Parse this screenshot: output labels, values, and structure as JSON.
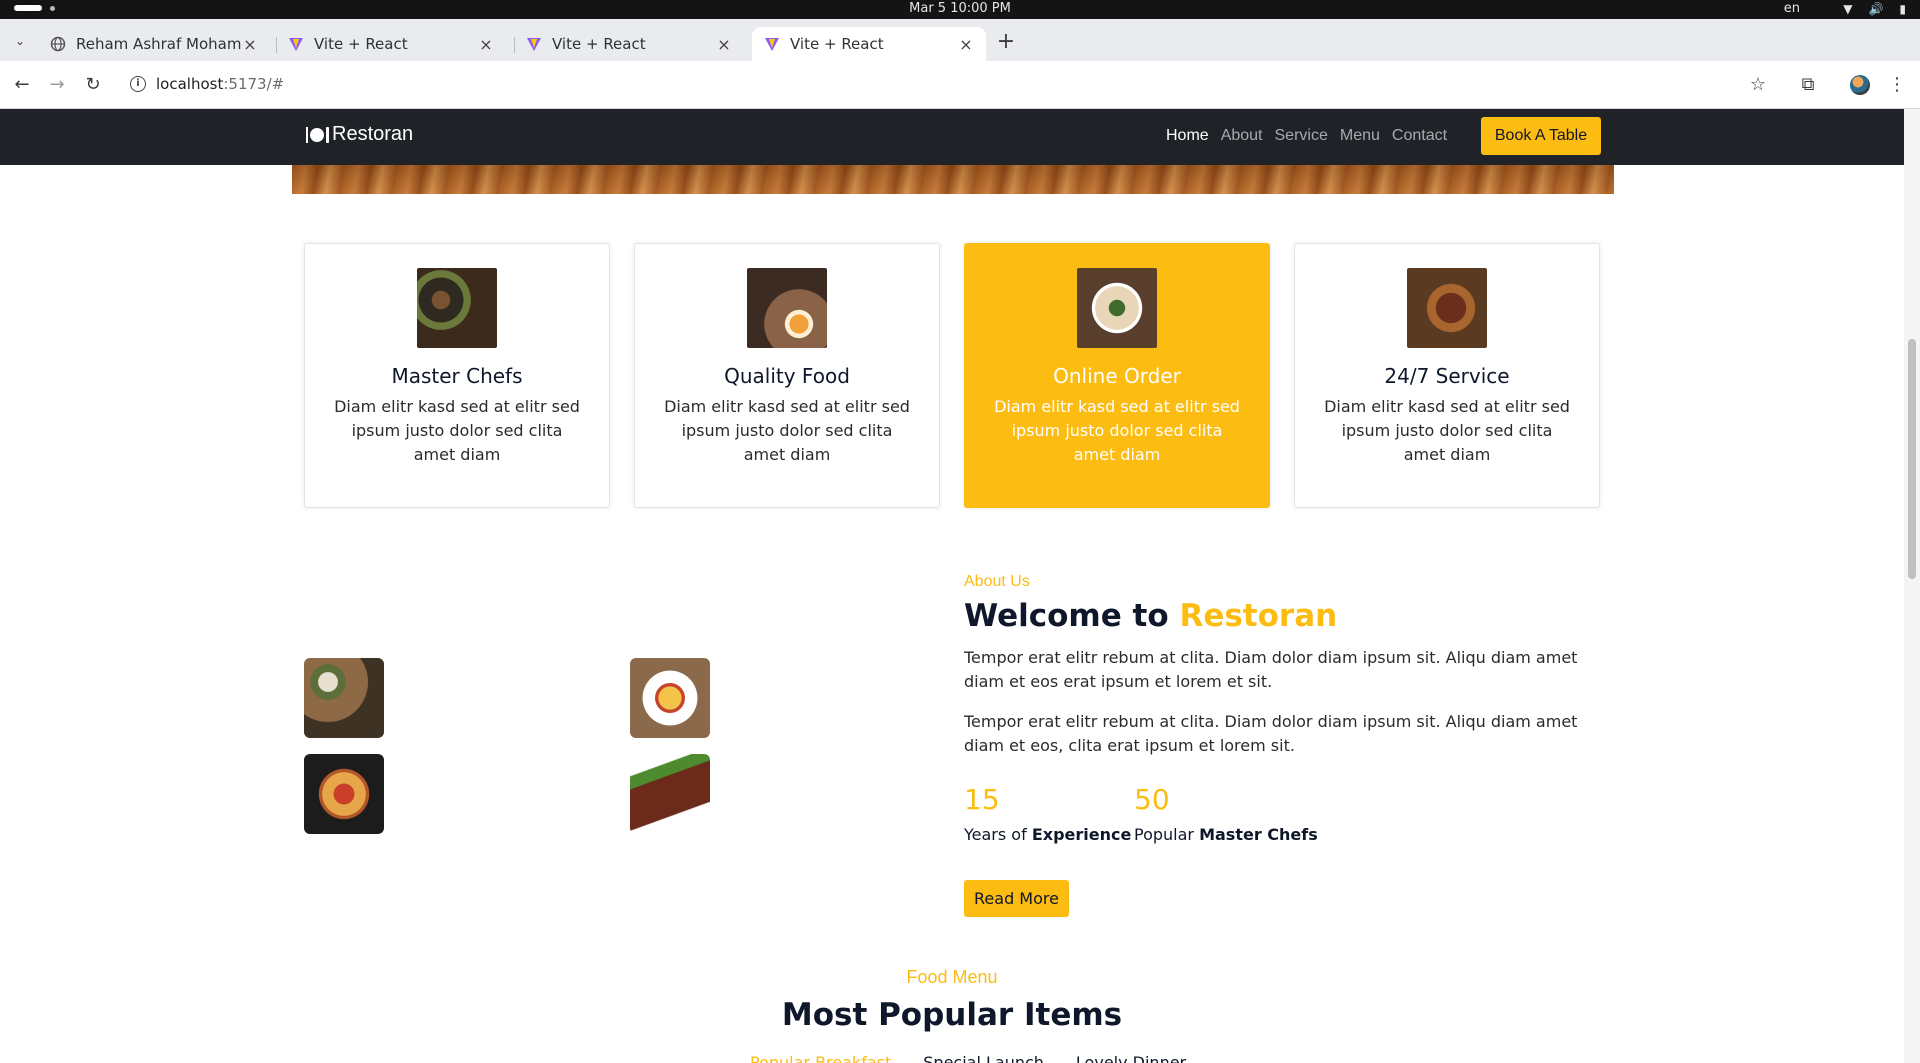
{
  "os": {
    "clock": "Mar 5  10:00 PM",
    "lang": "en"
  },
  "browser": {
    "tabs": [
      {
        "title": "Reham Ashraf Mohamme",
        "favicon": "globe-icon"
      },
      {
        "title": "Vite + React",
        "favicon": "vite-icon"
      },
      {
        "title": "Vite + React",
        "favicon": "vite-icon"
      },
      {
        "title": "Vite + React",
        "favicon": "vite-icon"
      }
    ],
    "active_tab": 3,
    "url_host": "localhost",
    "url_rest": ":5173/#"
  },
  "site": {
    "brand": "Restoran",
    "nav": [
      "Home",
      "About",
      "Service",
      "Menu",
      "Contact"
    ],
    "active_nav": "Home",
    "book_label": "Book A Table",
    "accent_color": "#fdbc12",
    "dark_color": "#0f172b"
  },
  "services": [
    {
      "title": "Master Chefs",
      "text": "Diam elitr kasd sed at elitr sed ipsum justo dolor sed clita amet diam"
    },
    {
      "title": "Quality Food",
      "text": "Diam elitr kasd sed at elitr sed ipsum justo dolor sed clita amet diam"
    },
    {
      "title": "Online Order",
      "text": "Diam elitr kasd sed at elitr sed ipsum justo dolor sed clita amet diam"
    },
    {
      "title": "24/7 Service",
      "text": "Diam elitr kasd sed at elitr sed ipsum justo dolor sed clita amet diam"
    }
  ],
  "about": {
    "eyebrow": "About Us",
    "title_prefix": "Welcome to ",
    "title_accent": "Restoran",
    "paragraph1": "Tempor erat elitr rebum at clita. Diam dolor diam ipsum sit. Aliqu diam amet diam et eos erat ipsum et lorem et sit.",
    "paragraph2": "Tempor erat elitr rebum at clita. Diam dolor diam ipsum sit. Aliqu diam amet diam et eos, clita erat ipsum et lorem sit.",
    "stats": [
      {
        "number": "15",
        "label_prefix": "Years of ",
        "label_bold": "Experience"
      },
      {
        "number": "50",
        "label_prefix": "Popular ",
        "label_bold": "Master Chefs"
      }
    ],
    "read_more": "Read More"
  },
  "menu": {
    "eyebrow": "Food Menu",
    "title": "Most Popular Items",
    "tabs": [
      "Popular Breakfast",
      "Special Launch",
      "Lovely Dinner"
    ]
  }
}
